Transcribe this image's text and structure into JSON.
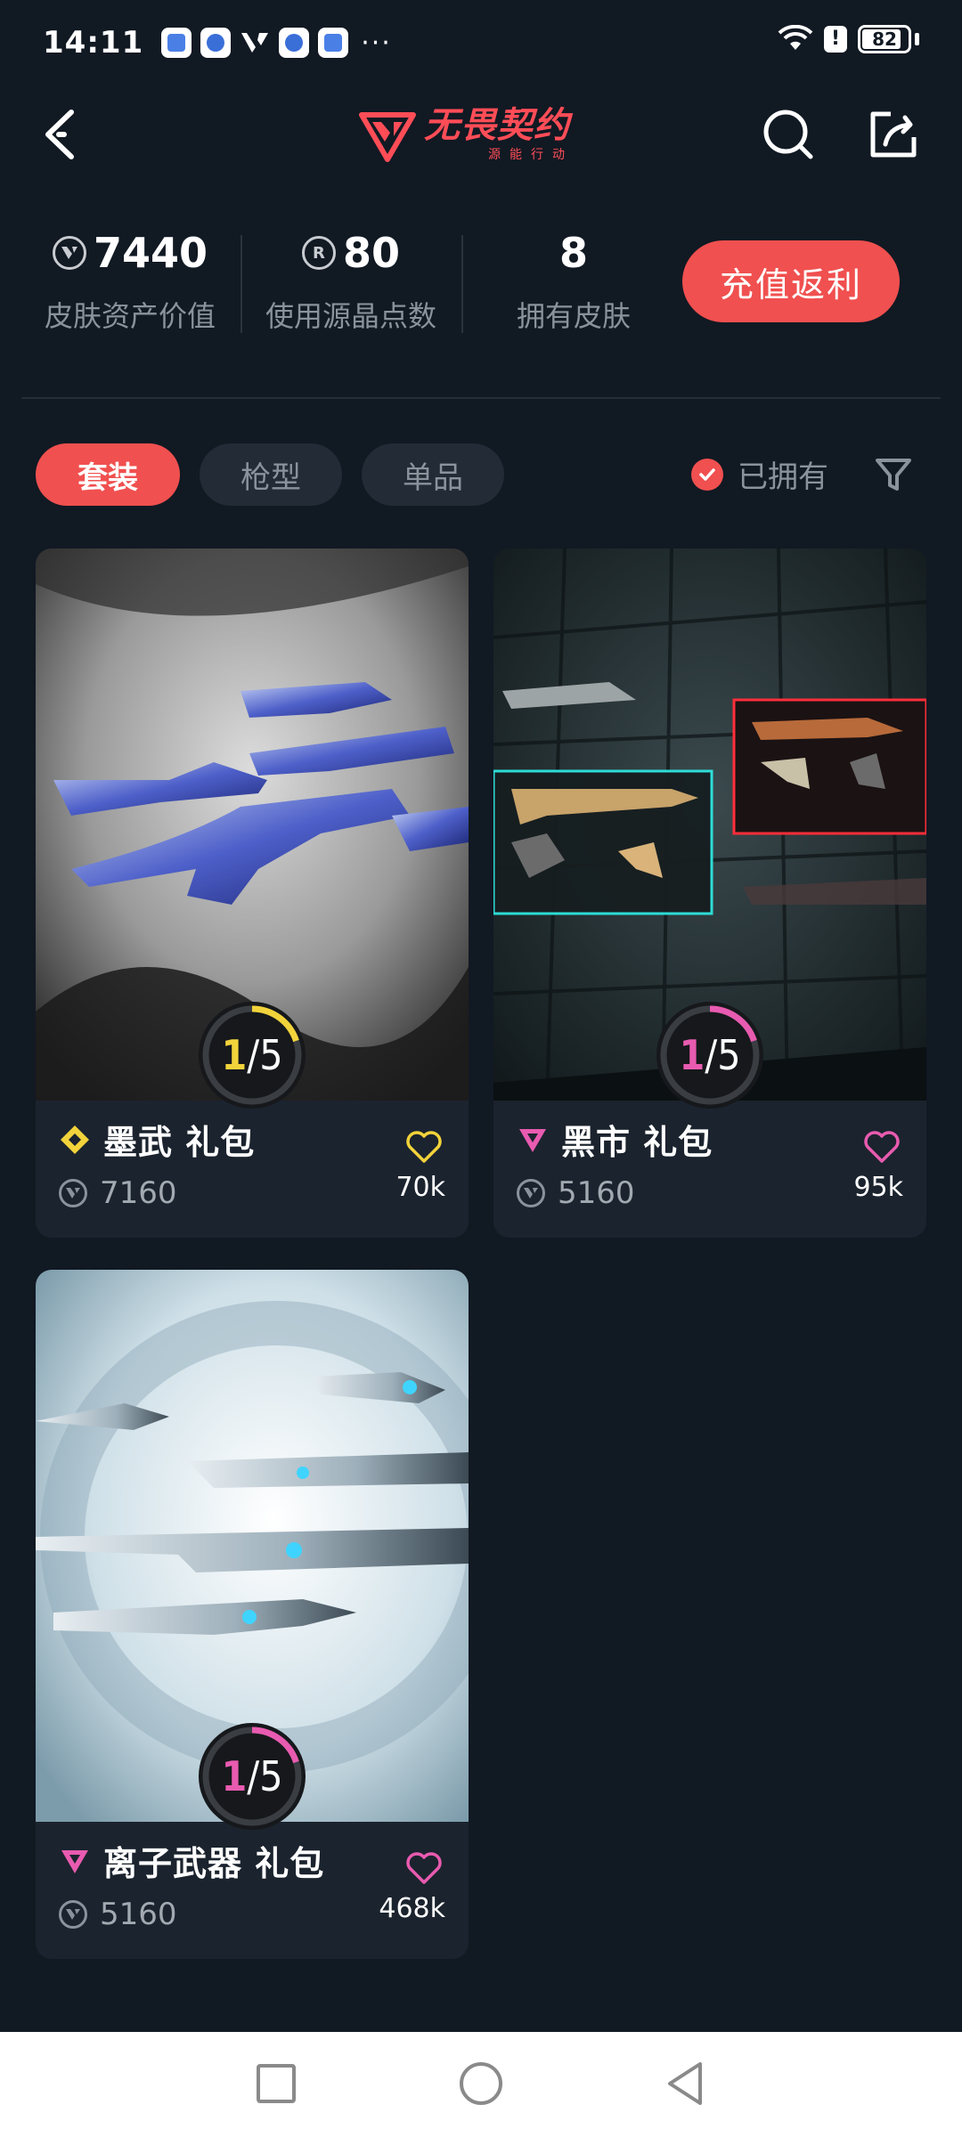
{
  "status_bar": {
    "time": "14:11",
    "more": "···",
    "battery": "82"
  },
  "header": {
    "logo_text": "无畏契约",
    "logo_subtitle": "源能行动",
    "accent_color": "#f0504f"
  },
  "stats": {
    "asset_value": "7440",
    "asset_value_label": "皮肤资产价值",
    "radianite_points": "80",
    "radianite_points_label": "使用源晶点数",
    "owned_skins": "8",
    "owned_skins_label": "拥有皮肤",
    "recharge_label": "充值返利"
  },
  "tabs": [
    {
      "label": "套装",
      "active": true
    },
    {
      "label": "枪型",
      "active": false
    },
    {
      "label": "单品",
      "active": false
    }
  ],
  "owned_filter_label": "已拥有",
  "bundles": [
    {
      "title": "墨武 礼包",
      "rarity": "diamond",
      "rarity_color": "#f2d33b",
      "price": "7160",
      "likes": "70k",
      "owned": "1",
      "total": "5",
      "owned_fraction": 0.2,
      "ring_color": "#f2d33b",
      "heart_color": "#f2d33b"
    },
    {
      "title": "黑市 礼包",
      "rarity": "triangle",
      "rarity_color": "#e85bb0",
      "price": "5160",
      "likes": "95k",
      "owned": "1",
      "total": "5",
      "owned_fraction": 0.2,
      "ring_color": "#e85bb0",
      "heart_color": "#e85bb0"
    },
    {
      "title": "离子武器 礼包",
      "rarity": "triangle",
      "rarity_color": "#e85bb0",
      "price": "5160",
      "likes": "468k",
      "owned": "1",
      "total": "5",
      "owned_fraction": 0.2,
      "ring_color": "#e85bb0",
      "heart_color": "#e85bb0"
    }
  ]
}
